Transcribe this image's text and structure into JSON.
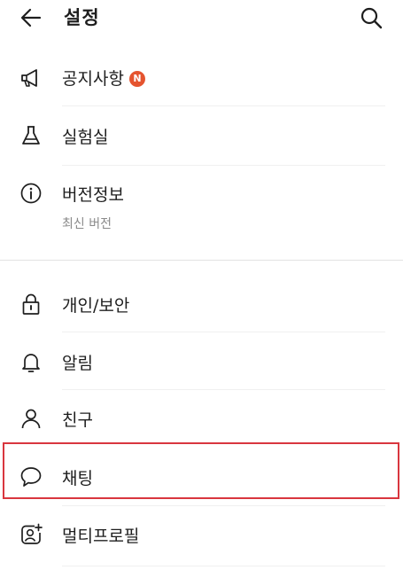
{
  "header": {
    "title": "설정",
    "back_icon": "arrow-left-icon",
    "search_icon": "search-icon"
  },
  "sections": [
    {
      "items": [
        {
          "id": "notice",
          "icon": "megaphone-icon",
          "label": "공지사항",
          "badge": "N"
        },
        {
          "id": "lab",
          "icon": "flask-icon",
          "label": "실험실"
        },
        {
          "id": "version",
          "icon": "info-icon",
          "label": "버전정보",
          "sublabel": "최신 버전"
        }
      ]
    },
    {
      "items": [
        {
          "id": "privacy",
          "icon": "lock-icon",
          "label": "개인/보안"
        },
        {
          "id": "alarm",
          "icon": "bell-icon",
          "label": "알림"
        },
        {
          "id": "friends",
          "icon": "person-icon",
          "label": "친구"
        },
        {
          "id": "chat",
          "icon": "chat-bubble-icon",
          "label": "채팅",
          "highlighted": true
        },
        {
          "id": "multiprofile",
          "icon": "profile-add-icon",
          "label": "멀티프로필"
        }
      ]
    }
  ],
  "colors": {
    "badge": "#e5542f",
    "highlight_border": "#d9363e",
    "text": "#1e1e1e",
    "subtext": "#8a8a8a"
  }
}
